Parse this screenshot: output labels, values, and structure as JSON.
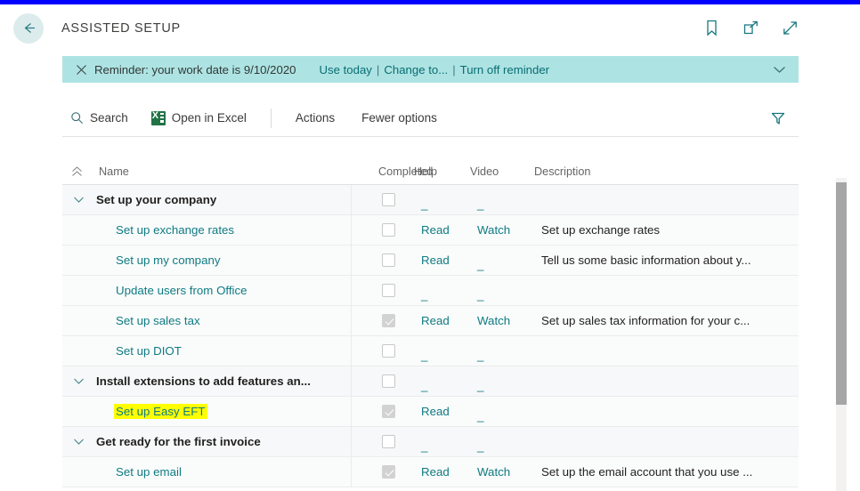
{
  "window": {
    "title": "ASSISTED SETUP",
    "accent_teal": "#0f7b82",
    "top_strip_color": "#0000ff",
    "notification_bg": "#aee3e3",
    "highlight_color": "#ffff00"
  },
  "header": {
    "back_label": "back-arrow",
    "icons": [
      {
        "name": "bookmark-icon",
        "label": "Bookmark"
      },
      {
        "name": "open-in-new-window-icon",
        "label": "Open in new window"
      },
      {
        "name": "expand-icon",
        "label": "Expand"
      }
    ]
  },
  "notification": {
    "close_label": "Close",
    "text": "Reminder: your work date is 9/10/2020",
    "actions": [
      {
        "label": "Use today"
      },
      {
        "label": "Change to..."
      },
      {
        "label": "Turn off reminder"
      }
    ],
    "separator": "|",
    "expand_label": "Show more"
  },
  "toolbar": {
    "search_label": "Search",
    "excel_label": "Open in Excel",
    "actions_label": "Actions",
    "fewer_options_label": "Fewer options",
    "filter_label": "Filter"
  },
  "table": {
    "columns": [
      {
        "key": "name",
        "label": "Name"
      },
      {
        "key": "completed",
        "label": "Completed"
      },
      {
        "key": "help",
        "label": "Help"
      },
      {
        "key": "video",
        "label": "Video"
      },
      {
        "key": "description",
        "label": "Description"
      }
    ],
    "placeholder": "_",
    "rows": [
      {
        "type": "group",
        "name": "Set up your company",
        "completed": false,
        "help": "_",
        "video": "_",
        "description": ""
      },
      {
        "type": "child",
        "name": "Set up exchange rates",
        "completed": false,
        "help": "Read",
        "video": "Watch",
        "description": "Set up exchange rates"
      },
      {
        "type": "child",
        "name": "Set up my company",
        "completed": false,
        "help": "Read",
        "video": "_",
        "description": "Tell us some basic information about y..."
      },
      {
        "type": "child",
        "name": "Update users from Office",
        "completed": false,
        "help": "_",
        "video": "_",
        "description": ""
      },
      {
        "type": "child",
        "name": "Set up sales tax",
        "completed": true,
        "help": "Read",
        "video": "Watch",
        "description": "Set up sales tax information for your c..."
      },
      {
        "type": "child",
        "name": "Set up DIOT",
        "completed": false,
        "help": "_",
        "video": "_",
        "description": ""
      },
      {
        "type": "group",
        "name": "Install extensions to add features an...",
        "completed": false,
        "help": "_",
        "video": "_",
        "description": ""
      },
      {
        "type": "child",
        "name": "Set up Easy EFT",
        "completed": true,
        "help": "Read",
        "video": "_",
        "description": "",
        "highlighted": true
      },
      {
        "type": "group",
        "name": "Get ready for the first invoice",
        "completed": false,
        "help": "_",
        "video": "_",
        "description": ""
      },
      {
        "type": "child",
        "name": "Set up email",
        "completed": true,
        "help": "Read",
        "video": "Watch",
        "description": "Set up the email account that you use ..."
      }
    ]
  }
}
